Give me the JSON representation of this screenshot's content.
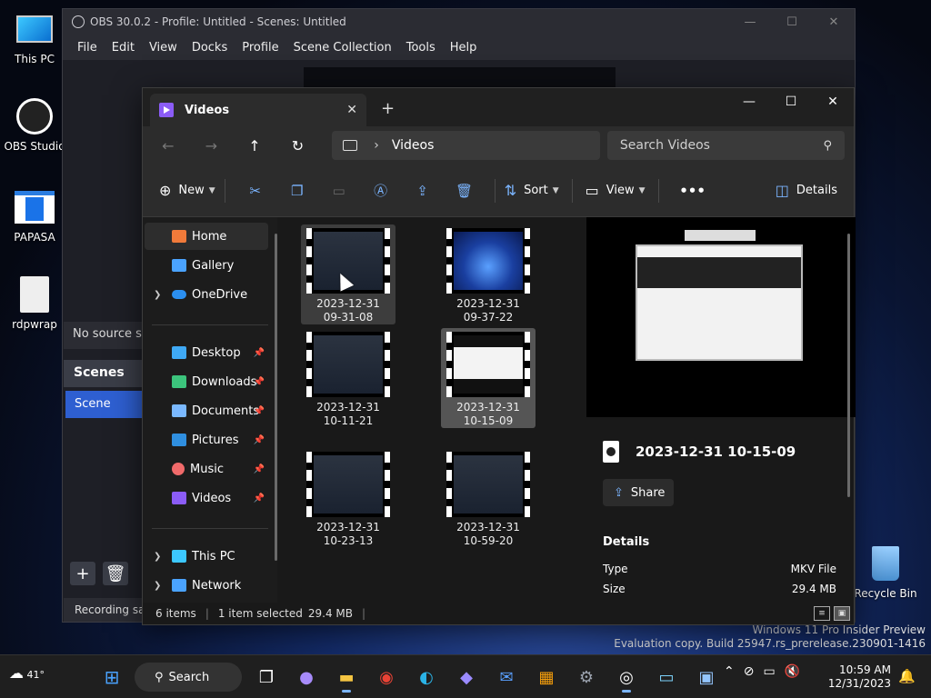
{
  "desktop": {
    "icons": [
      {
        "label": "This PC"
      },
      {
        "label": "OBS Studio"
      },
      {
        "label": "PAPASA"
      },
      {
        "label": "rdpwrap"
      },
      {
        "label": "Recycle Bin"
      }
    ],
    "watermark": {
      "line1": "Windows 11 Pro Insider Preview",
      "line2": "Evaluation copy. Build 25947.rs_prerelease.230901-1416"
    }
  },
  "obs": {
    "title": "OBS 30.0.2 - Profile: Untitled - Scenes: Untitled",
    "menu": [
      "File",
      "Edit",
      "View",
      "Docks",
      "Profile",
      "Scene Collection",
      "Tools",
      "Help"
    ],
    "no_source": "No source selected",
    "scenes_header": "Scenes",
    "scene_item": "Scene",
    "status": "Recording saved"
  },
  "explorer": {
    "tab_title": "Videos",
    "breadcrumb": "Videos",
    "search_placeholder": "Search Videos",
    "commands": {
      "new": "New",
      "sort": "Sort",
      "view": "View",
      "details": "Details"
    },
    "nav": {
      "home": "Home",
      "gallery": "Gallery",
      "onedrive": "OneDrive",
      "desktop": "Desktop",
      "downloads": "Downloads",
      "documents": "Documents",
      "pictures": "Pictures",
      "music": "Music",
      "videos": "Videos",
      "thispc": "This PC",
      "network": "Network"
    },
    "files": [
      {
        "line1": "2023-12-31",
        "line2": "09-31-08"
      },
      {
        "line1": "2023-12-31",
        "line2": "09-37-22"
      },
      {
        "line1": "2023-12-31",
        "line2": "10-11-21"
      },
      {
        "line1": "2023-12-31",
        "line2": "10-15-09"
      },
      {
        "line1": "2023-12-31",
        "line2": "10-23-13"
      },
      {
        "line1": "2023-12-31",
        "line2": "10-59-20"
      }
    ],
    "detail": {
      "title": "2023-12-31 10-15-09",
      "share": "Share",
      "section": "Details",
      "type_label": "Type",
      "type_value": "MKV File",
      "size_label": "Size",
      "size_value": "29.4 MB"
    },
    "status": {
      "count": "6 items",
      "selected": "1 item selected",
      "size": "29.4 MB"
    }
  },
  "taskbar": {
    "weather": "41°",
    "search": "Search",
    "time": "10:59 AM",
    "date": "12/31/2023"
  }
}
